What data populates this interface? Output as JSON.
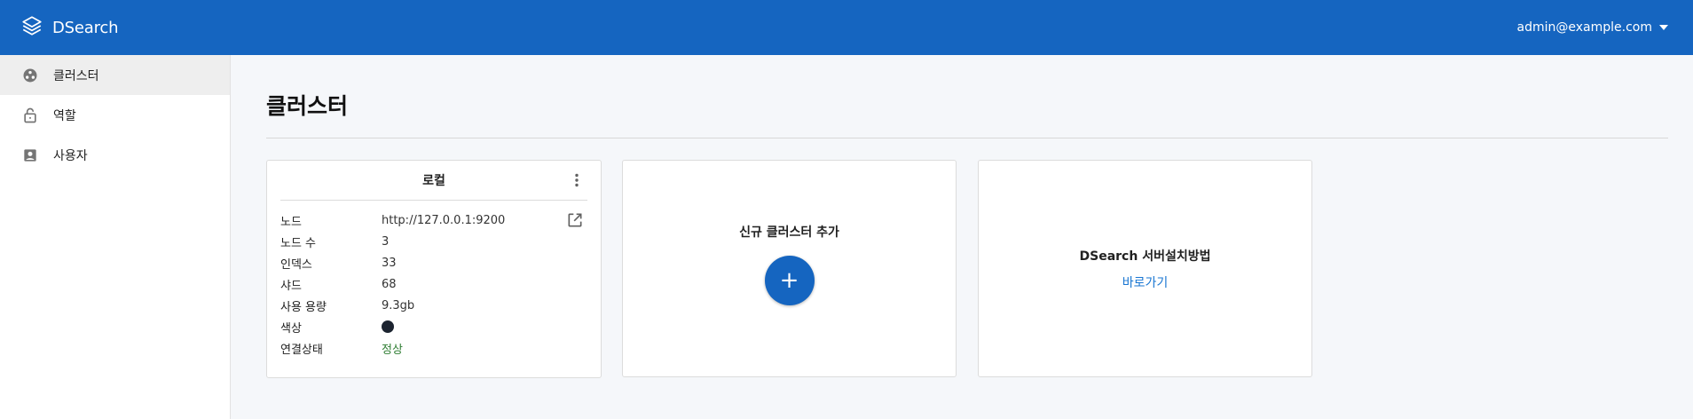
{
  "app": {
    "name": "DSearch",
    "user": "admin@example.com",
    "accent_color": "#1565c0"
  },
  "sidebar": {
    "items": [
      {
        "label": "클러스터",
        "icon": "cluster-icon",
        "active": true
      },
      {
        "label": "역할",
        "icon": "lock-icon",
        "active": false
      },
      {
        "label": "사용자",
        "icon": "account-box-icon",
        "active": false
      }
    ]
  },
  "page": {
    "title": "클러스터"
  },
  "cards": {
    "local": {
      "title": "로컬",
      "rows": [
        {
          "key": "노드",
          "value": "http://127.0.0.1:9200"
        },
        {
          "key": "노드 수",
          "value": "3"
        },
        {
          "key": "인덱스",
          "value": "33"
        },
        {
          "key": "샤드",
          "value": "68"
        },
        {
          "key": "사용 용량",
          "value": "9.3gb"
        },
        {
          "key": "색상",
          "value": "#1c2430"
        },
        {
          "key": "연결상태",
          "value": "정상"
        }
      ]
    },
    "new_cluster": {
      "title": "신규 클러스터 추가",
      "button": "+"
    },
    "install": {
      "title": "DSearch 서버설치방법",
      "link": "바로가기"
    }
  }
}
